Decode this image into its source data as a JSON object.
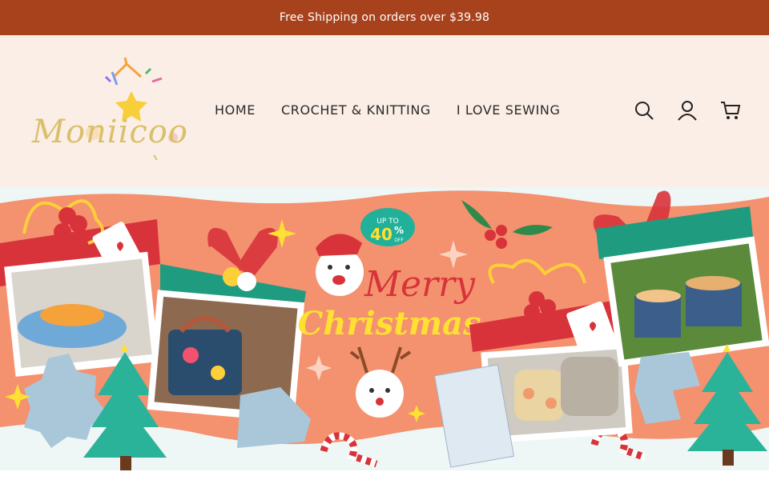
{
  "announcement": {
    "text": "Free Shipping on orders over $39.98"
  },
  "brand": {
    "name": "Moniicoo"
  },
  "nav": {
    "items": [
      {
        "label": "HOME"
      },
      {
        "label": "CROCHET & KNITTING"
      },
      {
        "label": "I LOVE SEWING"
      }
    ]
  },
  "header_icons": [
    "search-icon",
    "account-icon",
    "cart-icon"
  ],
  "banner": {
    "badge_top": "UP TO",
    "badge_value": "40",
    "badge_pct": "%",
    "badge_off": "OFF",
    "headline_1": "Merry",
    "headline_2": "Christmas"
  },
  "colors": {
    "announcement_bg": "#a8421d",
    "header_bg": "#fbeee6",
    "banner_orange": "#f4916e",
    "ribbon_red": "#d8333a",
    "ribbon_green": "#1f9b80",
    "tree_green": "#2bb39a",
    "headline_red": "#d8333a",
    "headline_yellow": "#ffe033"
  }
}
